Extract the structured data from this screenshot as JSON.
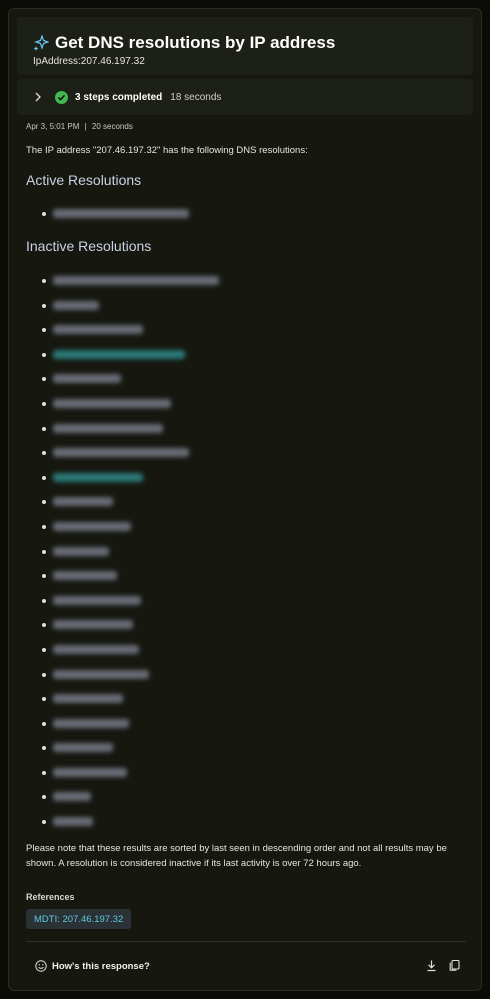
{
  "header": {
    "title": "Get DNS resolutions by IP address",
    "subtitle": "IpAddress:207.46.197.32",
    "icon": "sparkle-icon"
  },
  "steps": {
    "label": "3 steps completed",
    "duration": "18 seconds"
  },
  "response": {
    "timestamp": "Apr 3, 5:01 PM",
    "separator": "|",
    "elapsed": "20 seconds",
    "intro": "The IP address \"207.46.197.32\" has the following DNS resolutions:",
    "active_heading": "Active Resolutions",
    "inactive_heading": "Inactive Resolutions",
    "note": "Please note that these results are sorted by last seen in descending order and not all results may be shown. A resolution is considered inactive if its last activity is over 72 hours ago."
  },
  "references": {
    "label": "References",
    "items": [
      "MDTI: 207.46.197.32"
    ]
  },
  "footer": {
    "feedback_label": "How's this response?",
    "icons": [
      "smiley-icon",
      "download-icon",
      "copy-icon"
    ]
  },
  "colors": {
    "background": "#161810",
    "accent": "#5ec8e0",
    "success": "#3fb950",
    "heading": "#c9d1e4"
  }
}
